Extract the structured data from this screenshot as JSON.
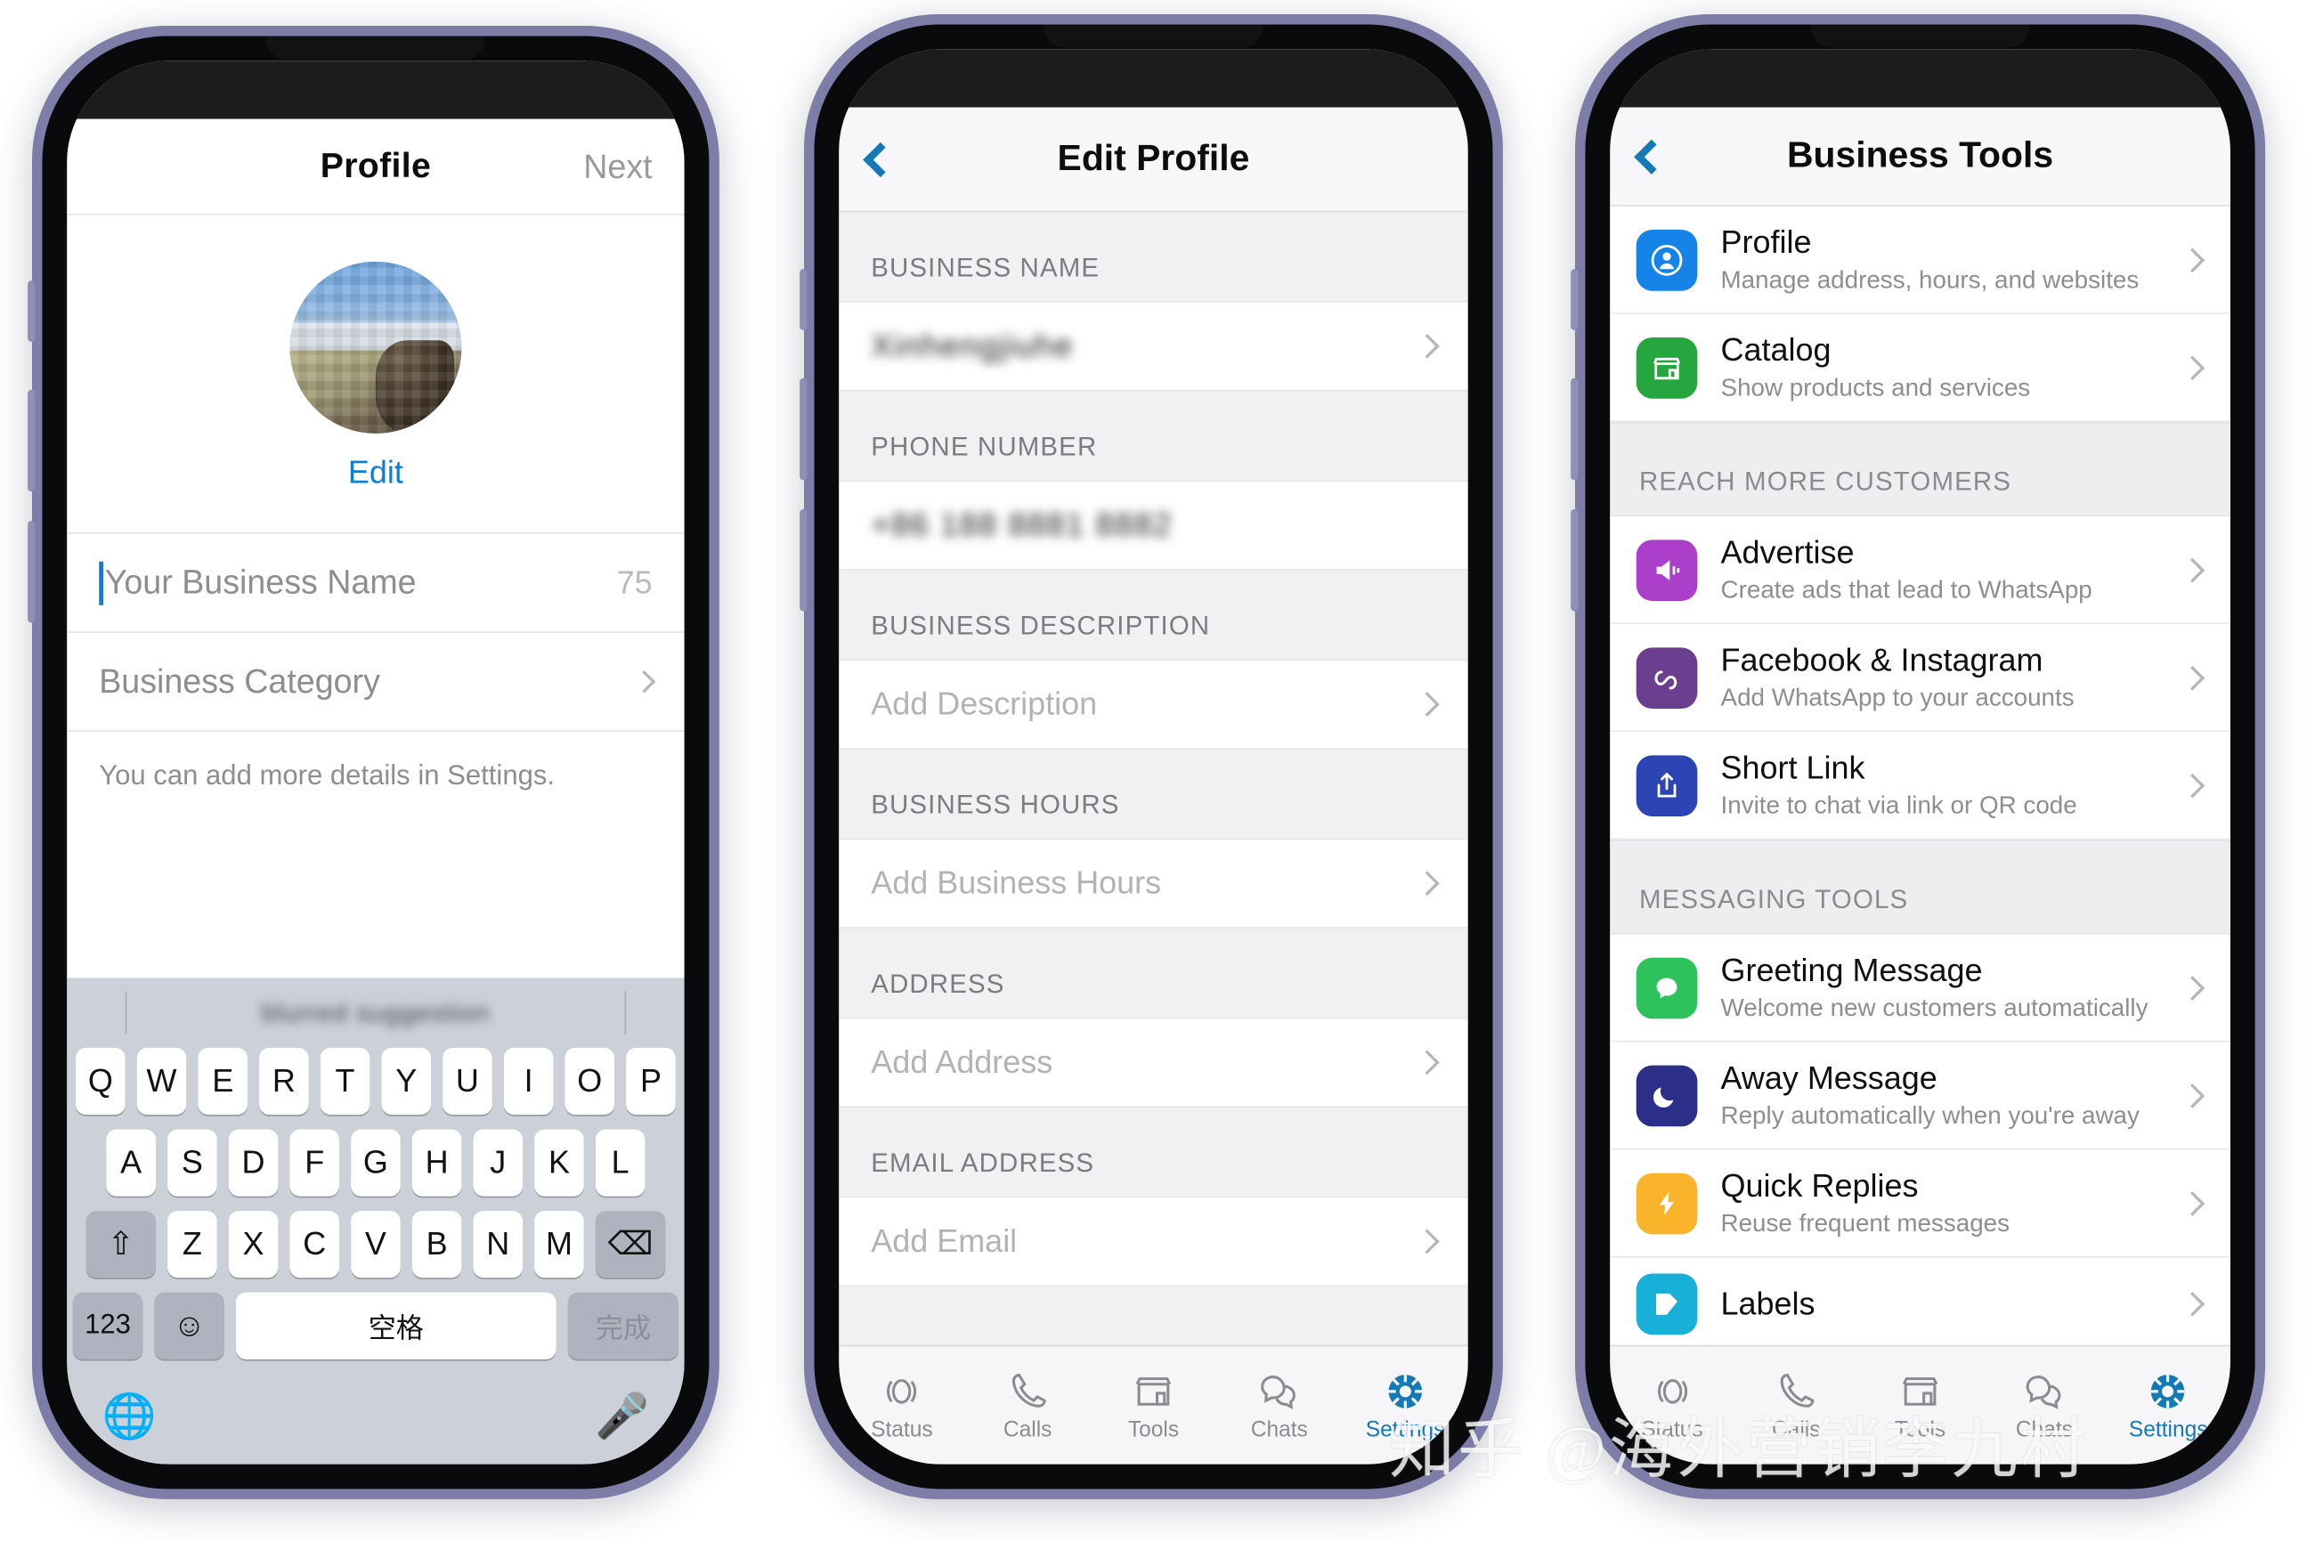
{
  "watermark": "知乎 @海外营销李九村",
  "phone1": {
    "nav": {
      "title": "Profile",
      "next_label": "Next"
    },
    "avatar_alt": "business-profile-photo",
    "edit_label": "Edit",
    "fields": [
      {
        "placeholder": "Your Business Name",
        "counter": "75"
      },
      {
        "placeholder": "Business Category"
      }
    ],
    "hint": "You can add more details in Settings.",
    "keyboard": {
      "prediction": "blurred suggestion",
      "row1": [
        "Q",
        "W",
        "E",
        "R",
        "T",
        "Y",
        "U",
        "I",
        "O",
        "P"
      ],
      "row2": [
        "A",
        "S",
        "D",
        "F",
        "G",
        "H",
        "J",
        "K",
        "L"
      ],
      "row3": [
        "Z",
        "X",
        "C",
        "V",
        "B",
        "N",
        "M"
      ],
      "shift_label": "⇧",
      "backspace_label": "⌫",
      "num_label": "123",
      "emoji_label": "☺",
      "space_label": "空格",
      "done_label": "完成",
      "globe_label": "globe",
      "mic_label": "mic"
    }
  },
  "phone2": {
    "nav": {
      "title": "Edit Profile",
      "back": "back"
    },
    "sections": [
      {
        "header": "BUSINESS NAME",
        "value": "Xinhengjiuhe",
        "blurred": true,
        "placeholder": ""
      },
      {
        "header": "PHONE NUMBER",
        "value": "+86 188 8881 8882",
        "blurred": true,
        "placeholder": ""
      },
      {
        "header": "BUSINESS DESCRIPTION",
        "value": "",
        "blurred": false,
        "placeholder": "Add Description"
      },
      {
        "header": "BUSINESS HOURS",
        "value": "",
        "blurred": false,
        "placeholder": "Add Business Hours"
      },
      {
        "header": "ADDRESS",
        "value": "",
        "blurred": false,
        "placeholder": "Add Address"
      },
      {
        "header": "EMAIL ADDRESS",
        "value": "",
        "blurred": false,
        "placeholder": "Add Email"
      }
    ],
    "tabs": [
      {
        "label": "Status",
        "icon": "status-icon",
        "active": false
      },
      {
        "label": "Calls",
        "icon": "phone-icon",
        "active": false
      },
      {
        "label": "Tools",
        "icon": "store-icon",
        "active": false
      },
      {
        "label": "Chats",
        "icon": "chats-icon",
        "active": false
      },
      {
        "label": "Settings",
        "icon": "gear-icon",
        "active": true
      }
    ]
  },
  "phone3": {
    "nav": {
      "title": "Business Tools",
      "back": "back"
    },
    "groups": [
      {
        "header": "",
        "items": [
          {
            "title": "Profile",
            "sub": "Manage address, hours, and websites",
            "icon": "profile-icon",
            "color": "#1583e8"
          },
          {
            "title": "Catalog",
            "sub": "Show products and services",
            "icon": "store-icon",
            "color": "#25a63f"
          }
        ]
      },
      {
        "header": "REACH MORE CUSTOMERS",
        "items": [
          {
            "title": "Advertise",
            "sub": "Create ads that lead to WhatsApp",
            "icon": "megaphone-icon",
            "color": "#ab3fc9"
          },
          {
            "title": "Facebook & Instagram",
            "sub": "Add WhatsApp to your accounts",
            "icon": "meta-icon",
            "color": "#6b3f8f"
          },
          {
            "title": "Short Link",
            "sub": "Invite to chat via link or QR code",
            "icon": "share-icon",
            "color": "#2d44b5"
          }
        ]
      },
      {
        "header": "MESSAGING TOOLS",
        "items": [
          {
            "title": "Greeting Message",
            "sub": "Welcome new customers automatically",
            "icon": "chat-bubble-icon",
            "color": "#2ec25d"
          },
          {
            "title": "Away Message",
            "sub": "Reply automatically when you're away",
            "icon": "moon-icon",
            "color": "#2b2f88"
          },
          {
            "title": "Quick Replies",
            "sub": "Reuse frequent messages",
            "icon": "bolt-icon",
            "color": "#f9b42b"
          },
          {
            "title": "Labels",
            "sub": "",
            "icon": "label-icon",
            "color": "#18b0d8"
          }
        ]
      }
    ],
    "tabs": [
      {
        "label": "Status",
        "icon": "status-icon",
        "active": false
      },
      {
        "label": "Calls",
        "icon": "phone-icon",
        "active": false
      },
      {
        "label": "Tools",
        "icon": "store-icon",
        "active": false
      },
      {
        "label": "Chats",
        "icon": "chats-icon",
        "active": false
      },
      {
        "label": "Settings",
        "icon": "gear-icon",
        "active": true
      }
    ]
  },
  "colors": {
    "accent_blue": "#1479b5",
    "link_blue": "#0c7fd4",
    "frame_purple": "#7d7da8"
  }
}
